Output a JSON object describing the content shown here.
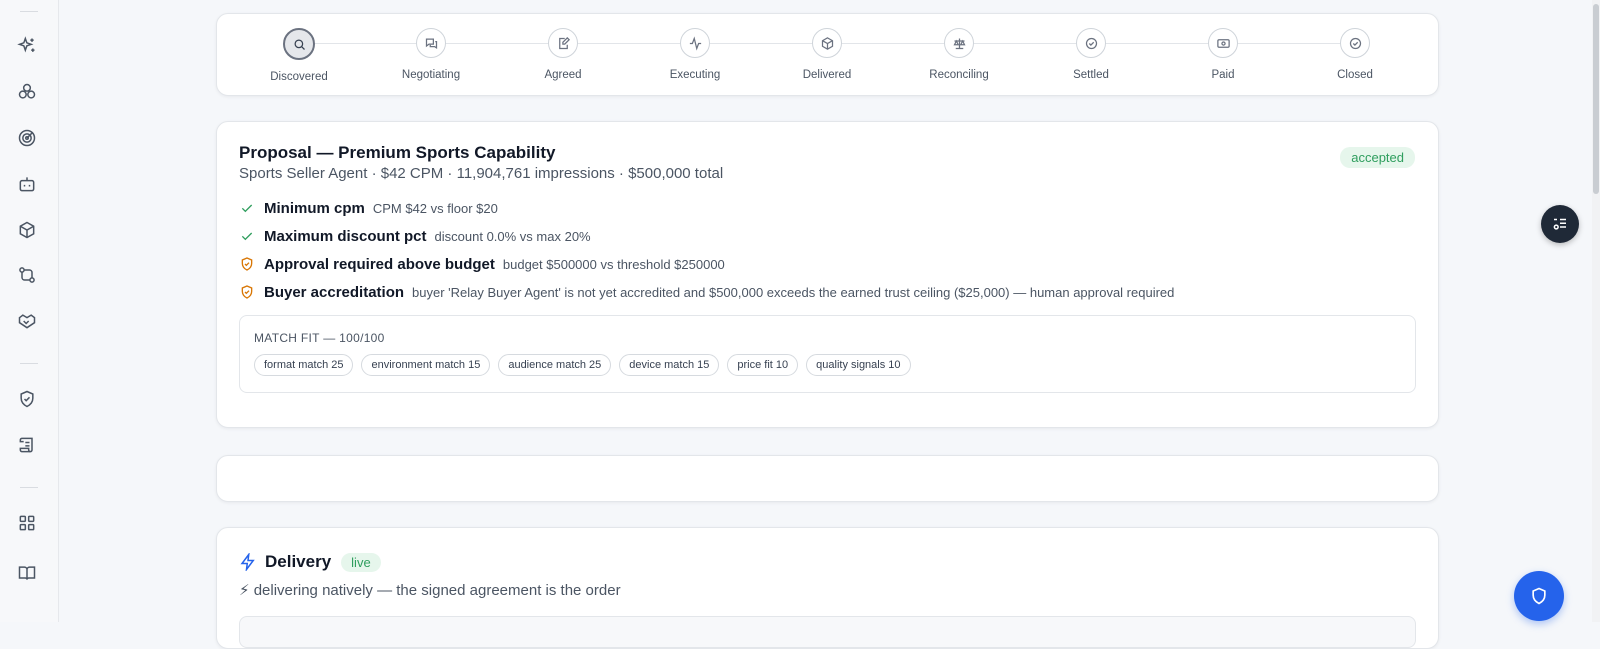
{
  "sidebar": {
    "icons": [
      "sparkles-icon",
      "layers-icon",
      "target-icon",
      "bot-icon",
      "package-icon",
      "git-compare-icon",
      "handshake-icon",
      "shield-check-icon",
      "scroll-icon",
      "grid-icon",
      "book-icon"
    ]
  },
  "stepper": {
    "steps": [
      {
        "label": "Discovered",
        "icon": "search-icon",
        "active": true
      },
      {
        "label": "Negotiating",
        "icon": "chat-icon",
        "active": false
      },
      {
        "label": "Agreed",
        "icon": "edit-doc-icon",
        "active": false
      },
      {
        "label": "Executing",
        "icon": "activity-icon",
        "active": false
      },
      {
        "label": "Delivered",
        "icon": "package-icon",
        "active": false
      },
      {
        "label": "Reconciling",
        "icon": "scale-icon",
        "active": false
      },
      {
        "label": "Settled",
        "icon": "check-circle-icon",
        "active": false
      },
      {
        "label": "Paid",
        "icon": "cash-icon",
        "active": false
      },
      {
        "label": "Closed",
        "icon": "check-circle-icon",
        "active": false
      }
    ]
  },
  "proposal": {
    "title": "Proposal — Premium Sports Capability",
    "subtitle": "Sports Seller Agent · $42 CPM · 11,904,761 impressions · $500,000 total",
    "status": "accepted",
    "rules": [
      {
        "status": "pass",
        "title": "Minimum cpm",
        "detail": "CPM $42 vs floor $20"
      },
      {
        "status": "pass",
        "title": "Maximum discount pct",
        "detail": "discount 0.0% vs max 20%"
      },
      {
        "status": "warn",
        "title": "Approval required above budget",
        "detail": "budget $500000 vs threshold $250000"
      },
      {
        "status": "warn",
        "title": "Buyer accreditation",
        "detail": "buyer 'Relay Buyer Agent' is not yet accredited and $500,000 exceeds the earned trust ceiling ($25,000) — human approval required"
      }
    ],
    "match_fit": {
      "label": "MATCH FIT — 100/100",
      "chips": [
        "format match 25",
        "environment match 15",
        "audience match 25",
        "device match 15",
        "price fit 10",
        "quality signals 10"
      ]
    }
  },
  "delivery": {
    "title": "Delivery",
    "badge": "live",
    "subtitle": "⚡ delivering natively — the signed agreement is the order"
  },
  "colors": {
    "accent": "#2563eb",
    "success": "#2f9e5e",
    "success_bg": "#e6f6ec",
    "warning": "#d97706"
  }
}
